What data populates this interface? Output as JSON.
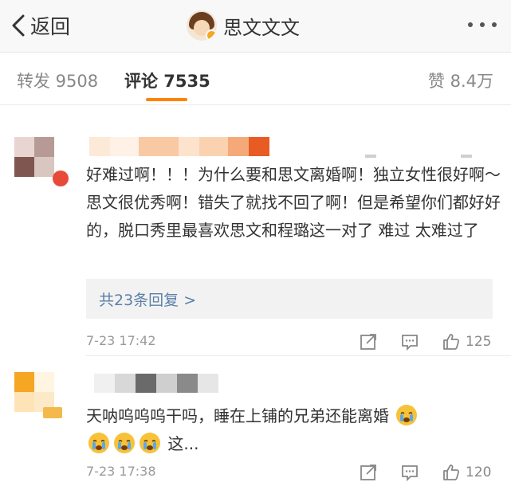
{
  "header": {
    "back_label": "返回",
    "title": "思文文文"
  },
  "tabs": {
    "repost": "转发 9508",
    "comments": "评论 7535",
    "likes": "赞 8.4万",
    "active_color": "#ff8200"
  },
  "comments": [
    {
      "text": "好难过啊！！！为什么要和思文离婚啊！独立女性很好啊～思文很优秀啊！错失了就找不回了啊！但是希望你们都好好的，脱口秀里最喜欢思文和程璐这一对了 难过 太难过了",
      "replies_label": "共23条回复 >",
      "time": "7-23 17:42",
      "likes": "125"
    },
    {
      "text": "天呐呜呜呜干吗，睡在上铺的兄弟还能离婚",
      "text_tail": "这...",
      "emoji": "crying-face",
      "time": "7-23 17:38",
      "likes": "120"
    }
  ],
  "icons": {
    "back": "chevron-left-icon",
    "more": "more-dots-icon",
    "share": "share-icon",
    "reply": "comment-icon",
    "like": "thumbs-up-icon"
  },
  "colors": {
    "link": "#5b7fa8",
    "replies_bg": "#f2f2f2",
    "emoji": "#f7c23a"
  }
}
